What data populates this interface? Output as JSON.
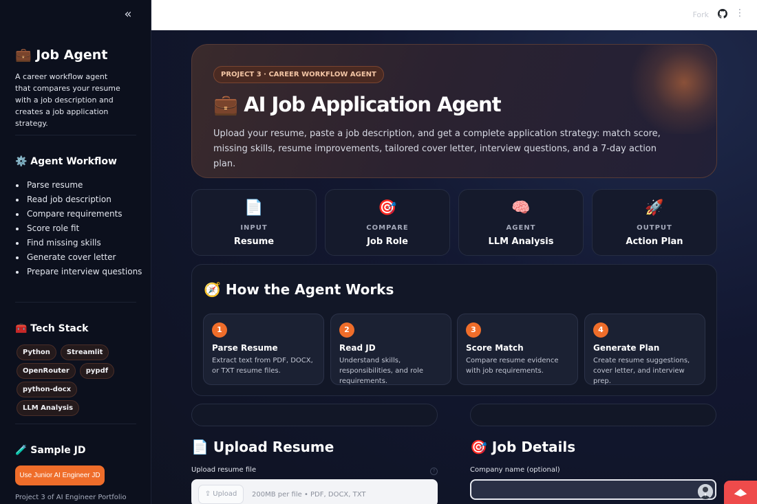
{
  "sidebar": {
    "title": "💼 Job Agent",
    "description": "A career workflow agent that compares your resume with a job description and creates a job application strategy.",
    "workflow_heading": "⚙️ Agent Workflow",
    "workflow": [
      "Parse resume",
      "Read job description",
      "Compare requirements",
      "Score role fit",
      "Find missing skills",
      "Generate cover letter",
      "Prepare interview questions"
    ],
    "tech_heading": "🧰 Tech Stack",
    "tech": [
      "Python",
      "Streamlit",
      "OpenRouter",
      "pypdf",
      "python-docx",
      "LLM Analysis"
    ],
    "sample_heading": "🧪 Sample JD",
    "sample_button": "Use Junior AI Engineer JD",
    "footer": "Project 3 of AI Engineer Portfolio"
  },
  "topbar": {
    "fork": "Fork",
    "icons": [
      "collapse-sidebar-icon",
      "github-icon",
      "more-menu-icon"
    ]
  },
  "hero": {
    "badge": "PROJECT 3 · CAREER WORKFLOW AGENT",
    "title": "💼 AI Job Application Agent",
    "subtitle": "Upload your resume, paste a job description, and get a complete application strategy: match score, missing skills, resume improvements, tailored cover letter, interview questions, and a 7-day action plan."
  },
  "pipeline": [
    {
      "icon": "📄",
      "label": "INPUT",
      "value": "Resume"
    },
    {
      "icon": "🎯",
      "label": "COMPARE",
      "value": "Job Role"
    },
    {
      "icon": "🧠",
      "label": "AGENT",
      "value": "LLM Analysis"
    },
    {
      "icon": "🚀",
      "label": "OUTPUT",
      "value": "Action Plan"
    }
  ],
  "how": {
    "title": "🧭 How the Agent Works",
    "steps": [
      {
        "num": "1",
        "title": "Parse Resume",
        "desc": "Extract text from PDF, DOCX, or TXT resume files."
      },
      {
        "num": "2",
        "title": "Read JD",
        "desc": "Understand skills, responsibilities, and role requirements."
      },
      {
        "num": "3",
        "title": "Score Match",
        "desc": "Compare resume evidence with job requirements."
      },
      {
        "num": "4",
        "title": "Generate Plan",
        "desc": "Create resume suggestions, cover letter, and interview prep."
      }
    ]
  },
  "upload": {
    "heading": "📄 Upload Resume",
    "label": "Upload resume file",
    "button": "Upload",
    "hint": "200MB per file • PDF, DOCX, TXT"
  },
  "job": {
    "heading": "🎯 Job Details",
    "company_label": "Company name (optional)",
    "company_value": ""
  },
  "colors": {
    "accent": "#ef6d2a",
    "background": "#0f1322",
    "deploy": "#ee4b4b"
  }
}
